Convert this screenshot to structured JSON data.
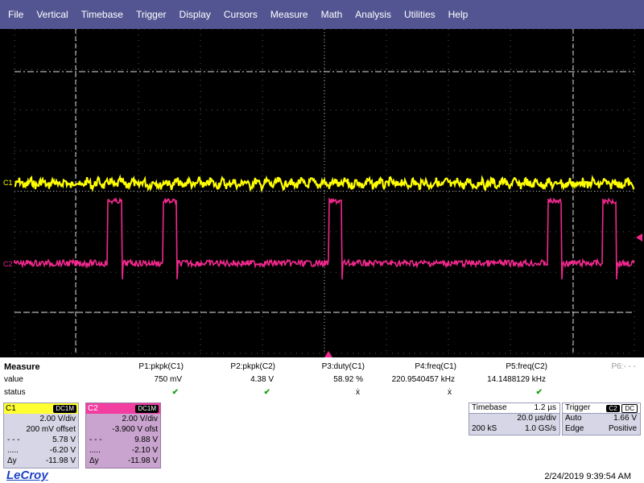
{
  "menu": [
    "File",
    "Vertical",
    "Timebase",
    "Trigger",
    "Display",
    "Cursors",
    "Measure",
    "Math",
    "Analysis",
    "Utilities",
    "Help"
  ],
  "scope": {
    "ch1_label": "C1",
    "ch2_label": "C2",
    "colors": {
      "ch1": "#ffff00",
      "ch2": "#f0288c",
      "grid": "#b4b4b4",
      "trigger_marker": "#f0288c"
    }
  },
  "measure": {
    "title": "Measure",
    "row_value": "value",
    "row_status": "status",
    "params": [
      {
        "name": "P1:pkpk(C1)",
        "value": "750 mV",
        "status": "ok"
      },
      {
        "name": "P2:pkpk(C2)",
        "value": "4.38 V",
        "status": "ok"
      },
      {
        "name": "P3:duty(C1)",
        "value": "58.92 %",
        "status": "warn"
      },
      {
        "name": "P4:freq(C1)",
        "value": "220.9540457 kHz",
        "status": "warn"
      },
      {
        "name": "P5:freq(C2)",
        "value": "14.1488129 kHz",
        "status": "ok"
      },
      {
        "name": "P6:- - -",
        "value": "",
        "status": ""
      }
    ],
    "ok_glyph": "✔",
    "warn_glyph": "ẋ"
  },
  "ch1": {
    "name": "C1",
    "coupling": "DC1M",
    "vdiv": "2.00 V/div",
    "offset": "200 mV offset",
    "cursor1_value": "5.78 V",
    "cursor2_value": "-6.20 V",
    "delta_label": "Δy",
    "delta_value": "-11.98 V"
  },
  "ch2": {
    "name": "C2",
    "coupling": "DC1M",
    "vdiv": "2.00 V/div",
    "offset": "-3.900 V ofst",
    "cursor1_value": "9.88 V",
    "cursor2_value": "-2.10 V",
    "delta_label": "Δy",
    "delta_value": "-11.98 V"
  },
  "timebase": {
    "title": "Timebase",
    "delay": "1.2 µs",
    "tdiv": "20.0 µs/div",
    "samples": "200 kS",
    "rate": "1.0 GS/s"
  },
  "trigger": {
    "title": "Trigger",
    "source_badge": "C2",
    "coupling_badge": "DC",
    "mode": "Auto",
    "level": "1.66 V",
    "type": "Edge",
    "slope": "Positive"
  },
  "logo": "LeCroy",
  "timestamp": "2/24/2019 9:39:54 AM"
}
